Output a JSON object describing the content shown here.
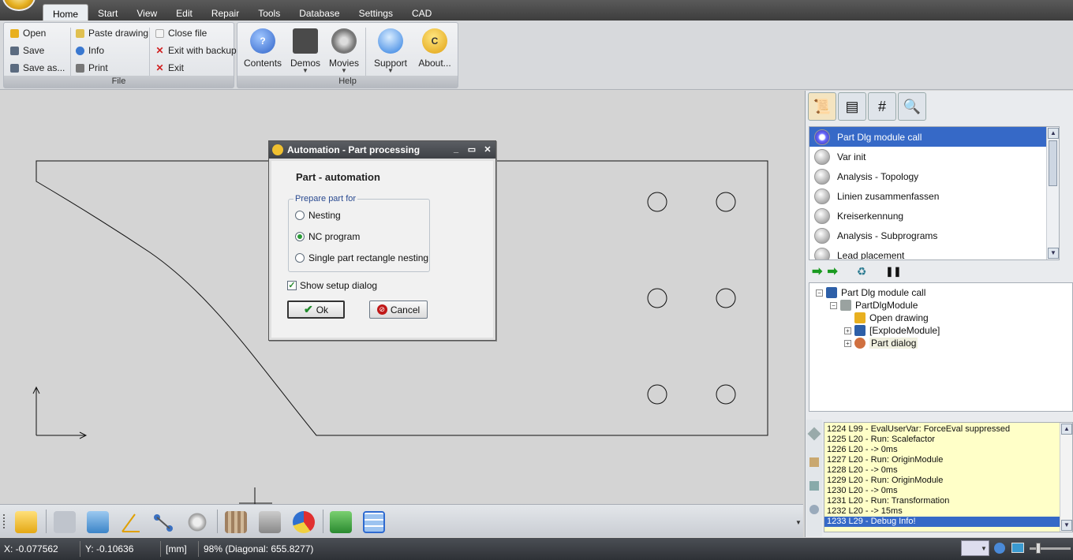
{
  "menu": {
    "tabs": [
      "Home",
      "Start",
      "View",
      "Edit",
      "Repair",
      "Tools",
      "Database",
      "Settings",
      "CAD"
    ],
    "active_tab": "Home"
  },
  "ribbon": {
    "file_group": {
      "label": "File",
      "open": "Open",
      "save": "Save",
      "save_as": "Save as...",
      "paste_drawing": "Paste drawing",
      "info": "Info",
      "print": "Print",
      "close_file": "Close file",
      "exit_with_backup": "Exit with backup",
      "exit": "Exit"
    },
    "help_group": {
      "label": "Help",
      "contents": "Contents",
      "demos": "Demos",
      "movies": "Movies",
      "support": "Support",
      "about": "About..."
    }
  },
  "dialog": {
    "title": "Automation - Part processing",
    "heading": "Part - automation",
    "group_label": "Prepare part for",
    "options": [
      "Nesting",
      "NC program",
      "Single part rectangle nesting"
    ],
    "selected_option": "NC program",
    "checkbox_label": "Show setup dialog",
    "checkbox_checked": true,
    "ok_label": "Ok",
    "cancel_label": "Cancel"
  },
  "steps": {
    "items": [
      "Part Dlg module call",
      "Var init",
      "Analysis - Topology",
      "Linien zusammenfassen",
      "Kreiserkennung",
      "Analysis - Subprograms",
      "Lead placement"
    ],
    "selected": "Part Dlg module call"
  },
  "tree": {
    "root": "Part Dlg module call",
    "module": "PartDlgModule",
    "child1": "Open drawing",
    "child2": "[ExplodeModule]",
    "child3": "Part dialog"
  },
  "log": {
    "lines": [
      "1224 L99 - EvalUserVar: ForceEval suppressed",
      "1225 L20 - Run: Scalefactor",
      "1226 L20 -  -> 0ms",
      "1227 L20 - Run: OriginModule",
      "1228 L20 -  -> 0ms",
      "1229 L20 - Run: OriginModule",
      "1230 L20 -  -> 0ms",
      "1231 L20 - Run: Transformation",
      "1232 L20 -  -> 15ms",
      "1233 L29 - Debug Info!"
    ],
    "selected_line": "1233 L29 - Debug Info!"
  },
  "status": {
    "x": "X: -0.077562",
    "y": "Y: -0.10636",
    "unit": "[mm]",
    "zoom": "98% (Diagonal: 655.8277)"
  },
  "colors": {
    "selection": "#3669c7",
    "log_bg": "#ffffc8",
    "canvas": "#d4d4d4"
  }
}
